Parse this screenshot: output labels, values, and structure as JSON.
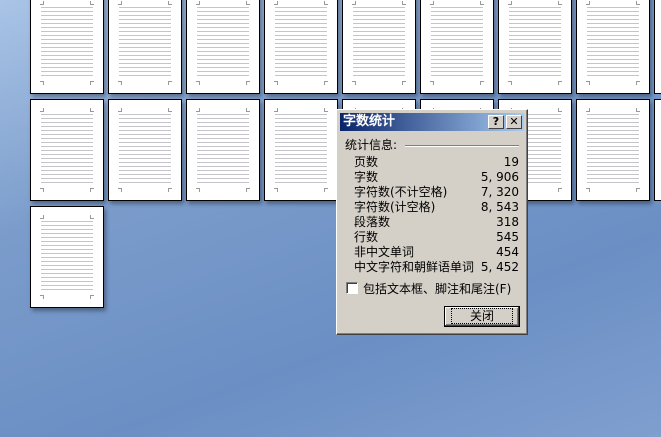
{
  "dialog": {
    "title": "字数统计",
    "help_label": "?",
    "close_x_label": "✕",
    "section_label": "统计信息:",
    "stats": [
      {
        "label": "页数",
        "value": "19"
      },
      {
        "label": "字数",
        "value": "5, 906"
      },
      {
        "label": "字符数(不计空格)",
        "value": "7, 320"
      },
      {
        "label": "字符数(计空格)",
        "value": "8, 543"
      },
      {
        "label": "段落数",
        "value": "318"
      },
      {
        "label": "行数",
        "value": "545"
      },
      {
        "label": "非中文单词",
        "value": "454"
      },
      {
        "label": "中文字符和朝鲜语单词",
        "value": "5, 452"
      }
    ],
    "checkbox_label": "包括文本框、脚注和尾注(F)",
    "checkbox_checked": false,
    "close_button_label": "关闭"
  }
}
